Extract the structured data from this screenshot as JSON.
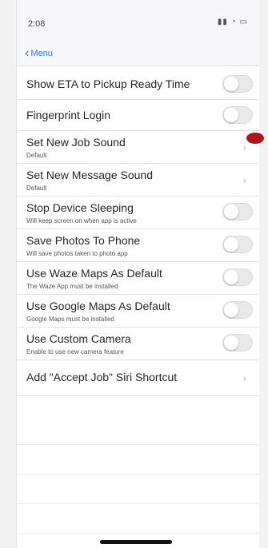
{
  "status_bar": {
    "time": "2:08",
    "icons": "signal wifi battery"
  },
  "nav": {
    "back_label": "Menu"
  },
  "rows": [
    {
      "title": "Show ETA to Pickup Ready Time",
      "subtitle": "",
      "accessory": "toggle"
    },
    {
      "title": "Fingerprint Login",
      "subtitle": "",
      "accessory": "toggle"
    },
    {
      "title": "Set New Job Sound",
      "subtitle": "Default",
      "accessory": "chevron"
    },
    {
      "title": "Set New Message Sound",
      "subtitle": "Default",
      "accessory": "chevron"
    },
    {
      "title": "Stop Device Sleeping",
      "subtitle": "Will keep screen on when app is active",
      "accessory": "toggle"
    },
    {
      "title": "Save Photos To Phone",
      "subtitle": "Will save photos taken to photo app",
      "accessory": "toggle"
    },
    {
      "title": "Use Waze Maps As Default",
      "subtitle": "The Waze App must be installed",
      "accessory": "toggle"
    },
    {
      "title": "Use Google Maps As Default",
      "subtitle": "Google Maps must be installed",
      "accessory": "toggle"
    },
    {
      "title": "Use Custom Camera",
      "subtitle": "Enable to use new camera feature",
      "accessory": "toggle"
    },
    {
      "title": "Add \"Accept Job\" Siri Shortcut",
      "subtitle": "",
      "accessory": "chevron"
    }
  ],
  "colors": {
    "accent": "#3478f6",
    "toggle_off": "#e9e9eb",
    "marker": "#b0141c"
  }
}
